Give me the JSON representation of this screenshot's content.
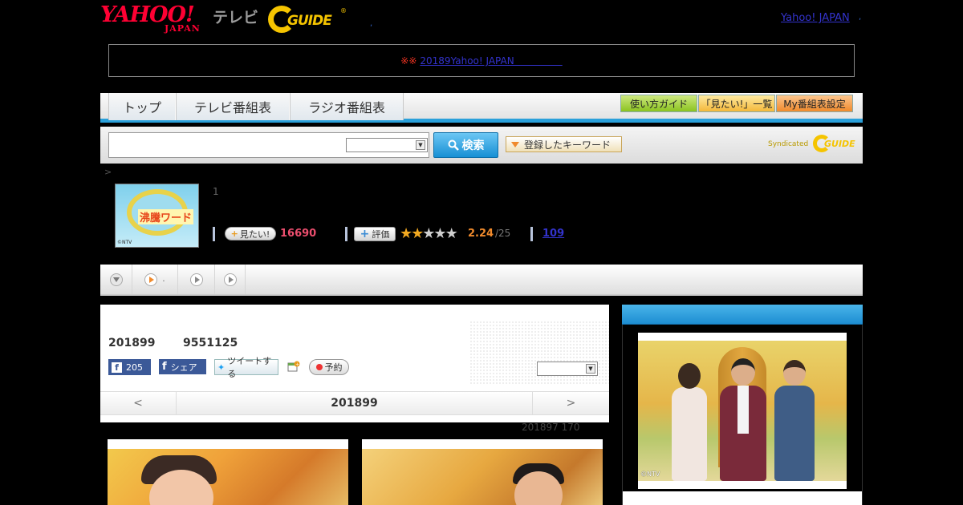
{
  "header": {
    "logo_text": "YAHOO!",
    "logo_sub": "JAPAN",
    "tv_label": "テレビ",
    "gguide_label": "GUIDE",
    "registered_mark": "®",
    "dot1": ",",
    "yahoo_japan_link": "Yahoo! JAPAN",
    "dot2": ","
  },
  "notice": {
    "marks": "※※",
    "link_text": "20189Yahoo! JAPAN　　　　　"
  },
  "nav": {
    "tabs": [
      {
        "label": "トップ"
      },
      {
        "label": "テレビ番組表"
      },
      {
        "label": "ラジオ番組表"
      }
    ],
    "guide_button": "使い方ガイド",
    "mitai_list_button": "「見たい!」一覧",
    "my_schedule_button": "My番組表設定"
  },
  "search": {
    "input_value": "",
    "select_value": "",
    "search_button": "検索",
    "keyword_button": "登録したキーワード",
    "syndicated_label": "Syndicated",
    "syndicated_logo": "GUIDE"
  },
  "breadcrumb": ">",
  "program": {
    "thumbnail_title": "沸騰ワード",
    "thumbnail_copyright": "©NTV",
    "episode_number": "1",
    "mitai_label": "見たい!",
    "mitai_plus": "+",
    "mitai_count": "16690",
    "hyoka_label": "評価",
    "hyoka_plus": "+",
    "rating": 2.24,
    "rating_text": "2.24",
    "rating_max": "/25",
    "stars_filled": 2,
    "stars_total": 5,
    "review_count": "109",
    "colors": {
      "accent": "#2aa0da",
      "mitai": "#ec4e6e",
      "score": "#f08a2c"
    }
  },
  "subnav": {
    "items": [
      {
        "label": "",
        "icon": "chevron-down-icon"
      },
      {
        "label": ".",
        "icon": "play-icon"
      },
      {
        "label": "",
        "icon": "play-icon"
      },
      {
        "label": "",
        "icon": "play-icon"
      }
    ]
  },
  "main": {
    "date": "201899",
    "time": "9551125",
    "facebook_count": "205",
    "share_label": "シェア",
    "tweet_label": "ツイートする",
    "reserve_label": "予約",
    "select_value": "",
    "pager_prev": "<",
    "pager_date": "201899",
    "pager_next": ">",
    "sub_info": "201897  170"
  },
  "right_panel": {
    "photo_copyright": "©NTV"
  }
}
